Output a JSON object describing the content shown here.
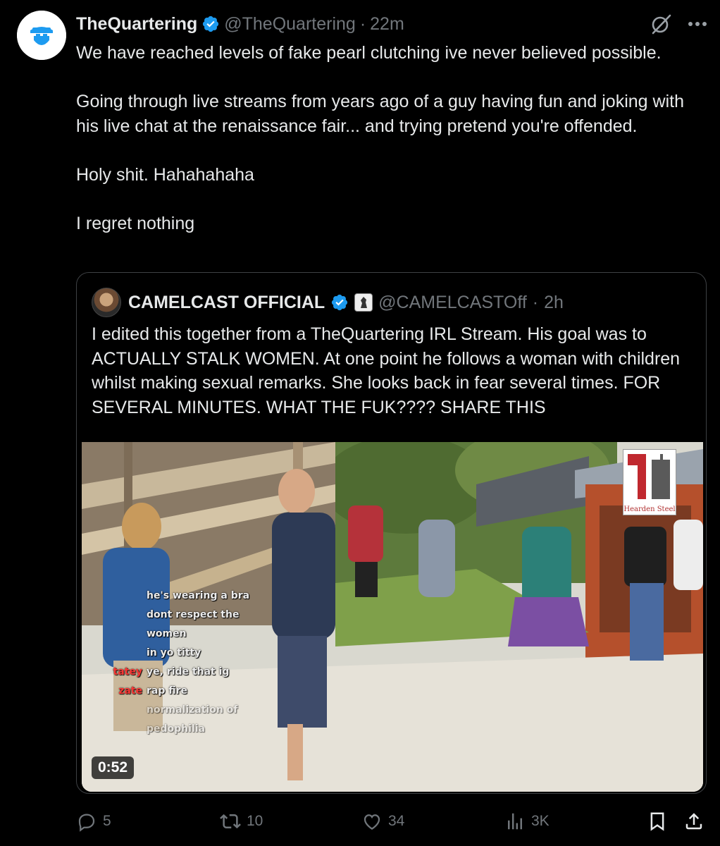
{
  "author": {
    "display_name": "TheQuartering",
    "handle": "@TheQuartering",
    "separator": "·",
    "time": "22m"
  },
  "header_icons": [
    "grok-icon",
    "more-icon"
  ],
  "tweet_text": [
    "We have reached levels of fake pearl clutching ive never believed possible.",
    "Going through live streams from years ago of a guy having fun and joking with his live chat at the renaissance fair... and trying pretend you're offended.",
    "Holy shit. Hahahahaha",
    "I regret nothing"
  ],
  "quote": {
    "display_name": "CAMELCAST OFFICIAL",
    "handle": "@CAMELCASTOff",
    "separator": "·",
    "time": "2h",
    "text": "I edited this together from a TheQuartering IRL Stream. His goal was to ACTUALLY STALK WOMEN. At one point he follows a woman with children whilst making sexual remarks. She looks back in fear several times. FOR SEVERAL MINUTES. WHAT THE FUK???? SHARE THIS",
    "video": {
      "duration": "0:52",
      "watermark": "Hearden Steel",
      "chat_overlay": [
        {
          "user": "",
          "msg": "he's wearing a bra"
        },
        {
          "user": "",
          "msg": "dont respect the"
        },
        {
          "user": "",
          "msg": "women"
        },
        {
          "user": "",
          "msg": "in yo titty"
        },
        {
          "user": "tatey",
          "msg": "ye, ride that ig"
        },
        {
          "user": "zate",
          "msg": "rap fire"
        },
        {
          "user": "",
          "msg": "normalization of"
        },
        {
          "user": "",
          "msg": "pedophilia"
        }
      ]
    }
  },
  "actions": {
    "replies": "5",
    "reposts": "10",
    "likes": "34",
    "views": "3K"
  },
  "colors": {
    "background": "#000000",
    "text": "#e7e9ea",
    "muted": "#71767b",
    "verified": "#1d9bf0",
    "border": "#3e4144"
  }
}
